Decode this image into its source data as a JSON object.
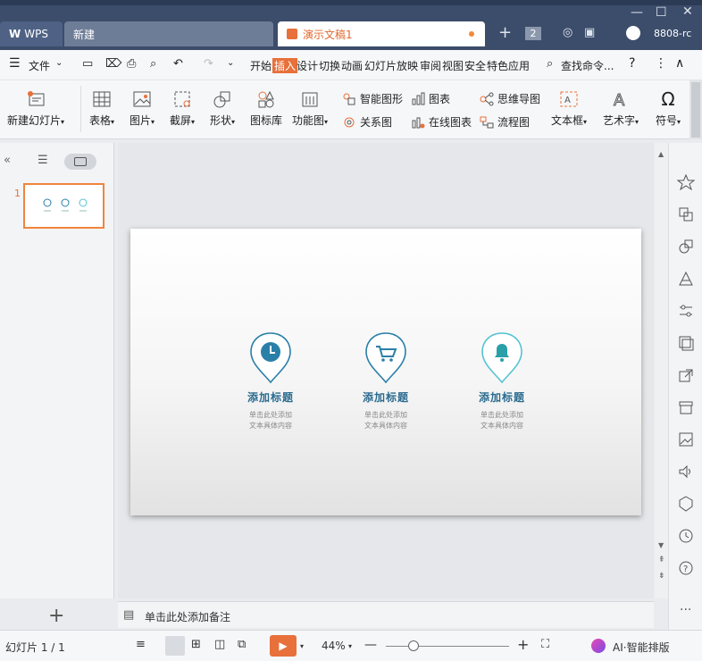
{
  "tabs": {
    "wps": "WPS",
    "new": "新建",
    "doc": "演示文稿1",
    "count": "2",
    "user": "8808-rc"
  },
  "menu": {
    "file": "文件",
    "items": [
      "开始",
      "插入",
      "设计",
      "切换",
      "动画",
      "幻灯片放映",
      "审阅",
      "视图",
      "安全",
      "特色应用"
    ],
    "active_index": 1,
    "search": "查找命令..."
  },
  "ribbon": {
    "new_slide": "新建幻灯片",
    "table": "表格",
    "picture": "图片",
    "screenshot": "截屏",
    "shape": "形状",
    "icon_lib": "图标库",
    "func_chart": "功能图",
    "smart_shape": "智能图形",
    "chart": "图表",
    "mindmap": "思维导图",
    "relation": "关系图",
    "online_chart": "在线图表",
    "flowchart": "流程图",
    "textbox": "文本框",
    "wordart": "艺术字",
    "symbol": "符号"
  },
  "slide_panel": {
    "slide_number": "1"
  },
  "slide": {
    "items": [
      {
        "title": "添加标题",
        "desc1": "单击此处添加",
        "desc2": "文本具体内容"
      },
      {
        "title": "添加标题",
        "desc1": "单击此处添加",
        "desc2": "文本具体内容"
      },
      {
        "title": "添加标题",
        "desc1": "单击此处添加",
        "desc2": "文本具体内容"
      }
    ]
  },
  "notes": {
    "placeholder": "单击此处添加备注"
  },
  "status": {
    "slide_count": "幻灯片 1 / 1",
    "zoom": "44%",
    "ai": "AI·智能排版",
    "zoom_level": 0.44
  },
  "colors": {
    "accent": "#e8703a",
    "titlebar": "#3c4d6b",
    "pin": "#2a7fa8",
    "pin_light": "#56c3d3"
  }
}
